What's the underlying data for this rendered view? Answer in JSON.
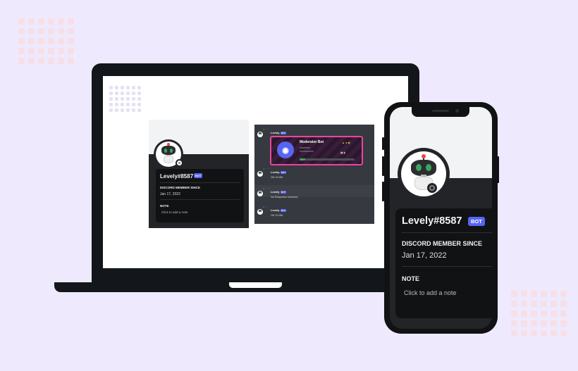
{
  "colors": {
    "background": "#efe9fd",
    "device_frame": "#13161a",
    "profile_card": "#111214",
    "bot_badge": "#5865f2",
    "embed_border": "#eb459e",
    "online_green": "#3ba55d"
  },
  "phone_profile": {
    "username": "Levely#8587",
    "bot_badge": "BOT",
    "member_since_heading": "DISCORD MEMBER SINCE",
    "member_since_date": "Jan 17, 2022",
    "note_heading": "NOTE",
    "note_placeholder": "Click to add a note",
    "avatar_icon": "robot-avatar-icon",
    "status_icon": "offline-status-icon"
  },
  "laptop_profile": {
    "username": "Levely#8587",
    "bot_badge": "BOT",
    "member_since_heading": "DISCORD MEMBER SINCE",
    "member_since_date": "Jan 17, 2022",
    "note_heading": "NOTE",
    "note_placeholder": "Click to add a note"
  },
  "laptop_chat": {
    "messages": [
      {
        "author": "Levely",
        "badge": "BOT",
        "has_embed": true
      },
      {
        "author": "Levely",
        "badge": "BOT",
        "text": "OK CLINK"
      },
      {
        "author": "Levely",
        "badge": "BOT",
        "text": "No Response received"
      },
      {
        "author": "Levely",
        "badge": "BOT",
        "text": "OK CLINK"
      }
    ],
    "embed": {
      "title": "Moderator Bot",
      "icon": "discord-logo-icon"
    }
  }
}
